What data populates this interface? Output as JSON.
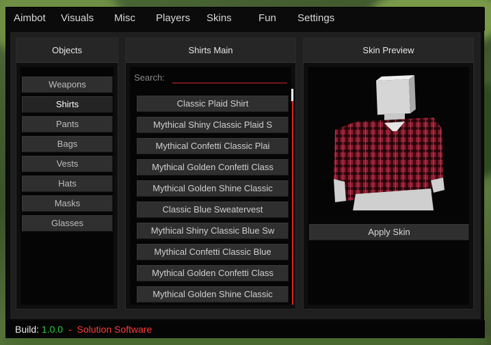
{
  "colors": {
    "accent": "#e02424",
    "version_green": "#2ecc40",
    "brand_red": "#ff3b3b"
  },
  "topbar": {
    "tabs": [
      "Aimbot",
      "Visuals",
      "Misc",
      "Players",
      "Skins",
      "Fun",
      "Settings"
    ]
  },
  "objects": {
    "title": "Objects",
    "items": [
      "Weapons",
      "Shirts",
      "Pants",
      "Bags",
      "Vests",
      "Hats",
      "Masks",
      "Glasses"
    ],
    "selected": "Shirts"
  },
  "shirts": {
    "title": "Shirts Main",
    "search_label": "Search:",
    "search_value": "",
    "items": [
      "Classic Plaid Shirt",
      "Mythical Shiny Classic Plaid S",
      "Mythical Confetti Classic Plai",
      "Mythical Golden Confetti Class",
      "Mythical Golden Shine Classic",
      "Classic Blue Sweatervest",
      "Mythical Shiny Classic Blue Sw",
      "Mythical Confetti Classic Blue",
      "Mythical Golden Confetti Class",
      "Mythical Golden Shine Classic"
    ]
  },
  "preview": {
    "title": "Skin Preview",
    "apply_label": "Apply Skin",
    "icon": "plaid-shirt-model"
  },
  "footer": {
    "build_label": "Build:",
    "version": "1.0.0",
    "separator": "-",
    "brand": "Solution Software"
  }
}
